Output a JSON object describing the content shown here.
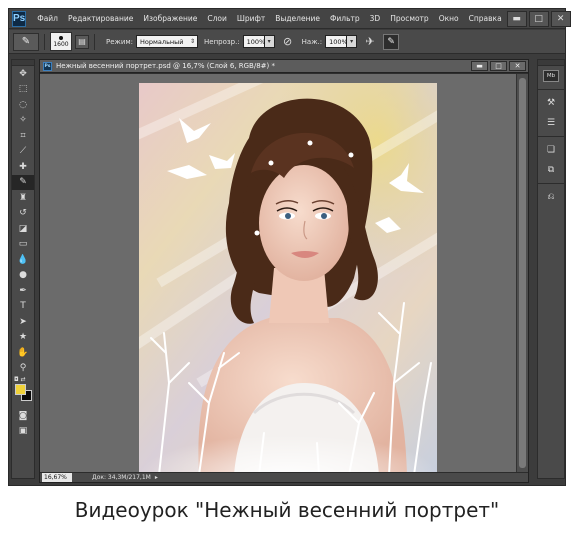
{
  "app": {
    "logo": "Ps",
    "menu": [
      "Файл",
      "Редактирование",
      "Изображение",
      "Слои",
      "Шрифт",
      "Выделение",
      "Фильтр",
      "3D",
      "Просмотр",
      "Окно",
      "Справка"
    ],
    "window_controls": [
      "▬",
      "□",
      "✕"
    ]
  },
  "options": {
    "brush_size": "1600",
    "mode_label": "Режим:",
    "mode_value": "Нормальный",
    "opacity_label": "Непрозр.:",
    "opacity_value": "100%",
    "flow_label": "Наж.:",
    "flow_value": "100%"
  },
  "document": {
    "tab_title": "Нежный весенний портрет.psd @ 16,7% (Слой 6, RGB/8#) *",
    "tab_controls": [
      "▬",
      "□",
      "✕"
    ],
    "zoom": "16,67%",
    "doc_info": "Док: 34,3M/217,1M"
  },
  "panels": {
    "mini_bridge": "Mb"
  },
  "caption": "Видеоурок \"Нежный весенний портрет\"",
  "colors": {
    "foreground": "#f0d23a",
    "background": "#0a0a0a",
    "ui_dark": "#3c3c3c",
    "canvas_bg": "#6b6b6b"
  },
  "icons": {
    "tools": [
      "move-icon",
      "marquee-icon",
      "lasso-icon",
      "quick-select-icon",
      "crop-icon",
      "eyedropper-icon",
      "healing-icon",
      "brush-icon",
      "clone-stamp-icon",
      "history-brush-icon",
      "eraser-icon",
      "gradient-icon",
      "blur-icon",
      "dodge-icon",
      "pen-icon",
      "type-icon",
      "path-select-icon",
      "shape-icon",
      "hand-icon",
      "zoom-icon"
    ]
  }
}
